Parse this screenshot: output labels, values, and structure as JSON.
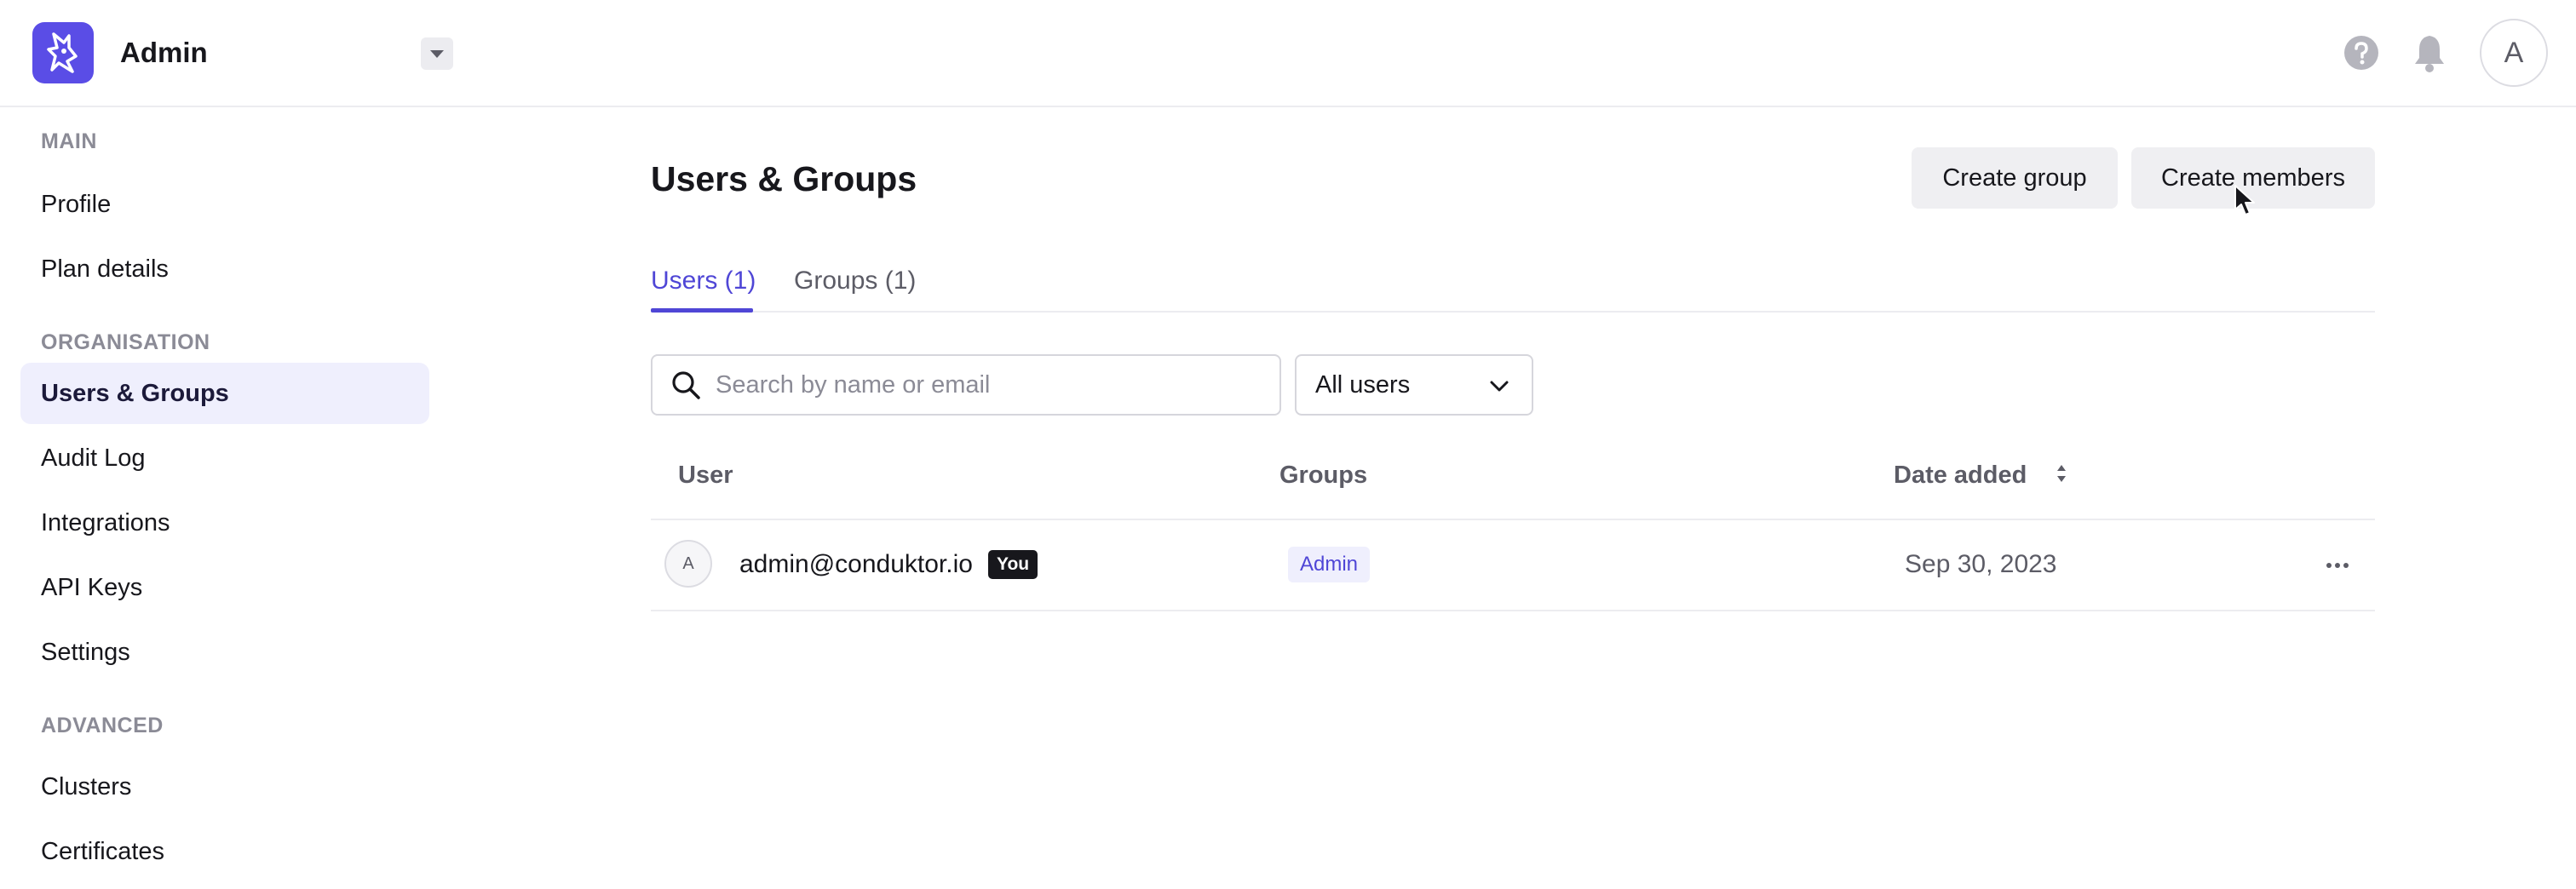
{
  "header": {
    "app_title": "Admin",
    "avatar_initial": "A",
    "icons": [
      "logo-icon",
      "caret-down-icon",
      "help-icon",
      "bell-icon"
    ]
  },
  "sidebar": {
    "sections": [
      {
        "title": "MAIN",
        "items": [
          {
            "label": "Profile"
          },
          {
            "label": "Plan details"
          }
        ]
      },
      {
        "title": "ORGANISATION",
        "items": [
          {
            "label": "Users & Groups",
            "active": true
          },
          {
            "label": "Audit Log"
          },
          {
            "label": "Integrations"
          },
          {
            "label": "API Keys"
          },
          {
            "label": "Settings"
          }
        ]
      },
      {
        "title": "ADVANCED",
        "items": [
          {
            "label": "Clusters"
          },
          {
            "label": "Certificates"
          }
        ]
      }
    ]
  },
  "main": {
    "title": "Users & Groups",
    "actions": {
      "create_group": "Create group",
      "create_members": "Create members"
    },
    "tabs": [
      {
        "label": "Users (1)",
        "active": true
      },
      {
        "label": "Groups (1)"
      }
    ],
    "search": {
      "placeholder": "Search by name or email",
      "value": ""
    },
    "filter": {
      "selected": "All users"
    },
    "table": {
      "columns": [
        "User",
        "Groups",
        "Date added"
      ],
      "rows": [
        {
          "avatar": "A",
          "email": "admin@conduktor.io",
          "badge": "You",
          "group": "Admin",
          "date_added": "Sep 30, 2023"
        }
      ]
    }
  },
  "colors": {
    "accent": "#4f46d6",
    "logo_bg": "#5a4de6",
    "active_nav_bg": "#efeffd",
    "button_bg": "#efeff2",
    "muted_text": "#5c5c66"
  }
}
